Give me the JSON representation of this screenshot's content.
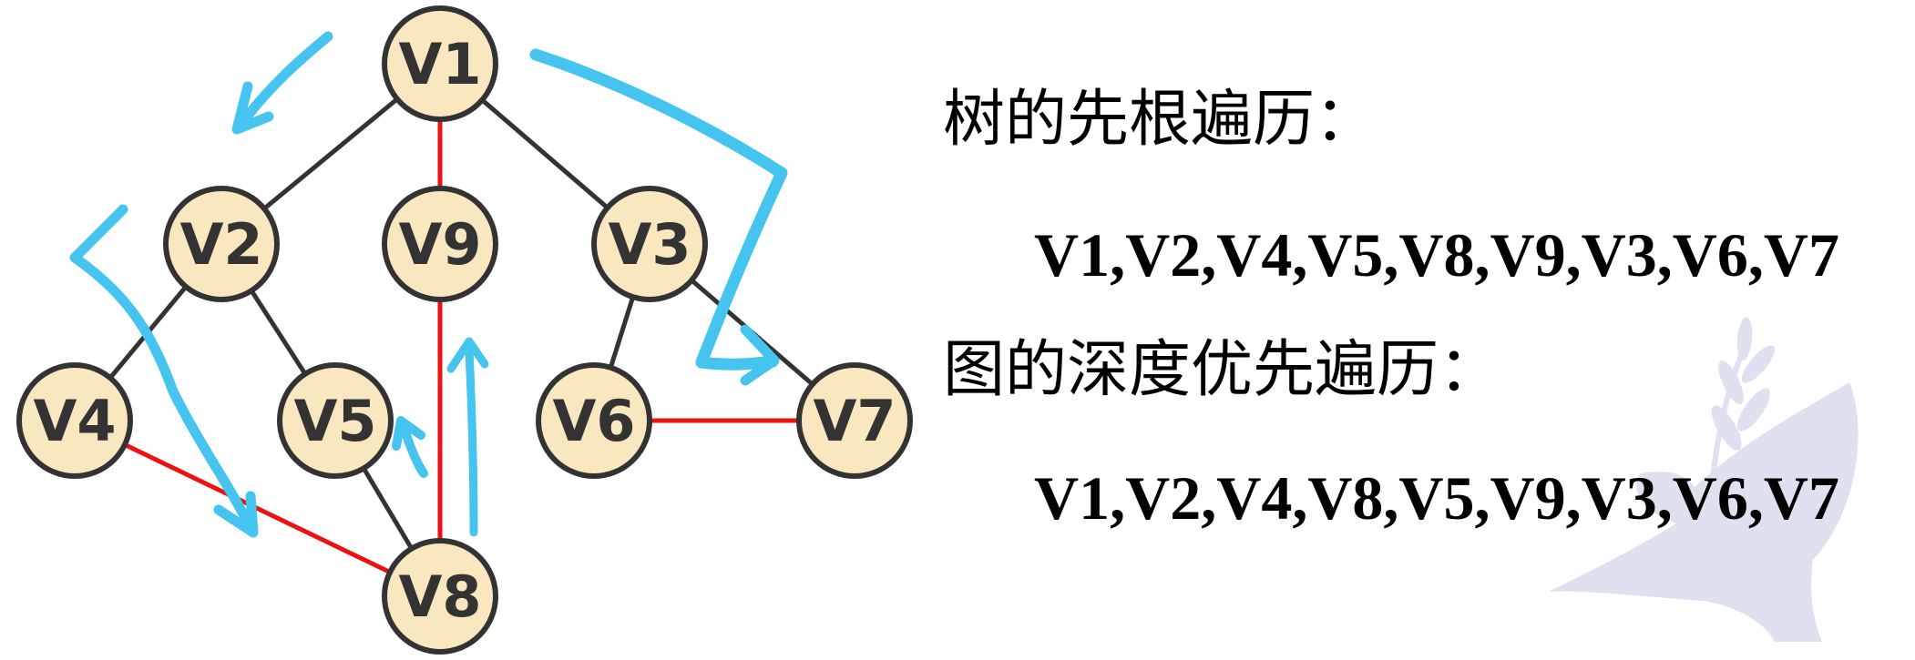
{
  "colors": {
    "node_fill": "#f9e7c0",
    "node_stroke": "#333333",
    "tree_edge": "#333333",
    "graph_edge": "#ee1111",
    "arrow": "#45c4f0",
    "watermark": "#dfe1f0"
  },
  "nodes": [
    {
      "id": "V1",
      "label": "V1"
    },
    {
      "id": "V2",
      "label": "V2"
    },
    {
      "id": "V9",
      "label": "V9"
    },
    {
      "id": "V3",
      "label": "V3"
    },
    {
      "id": "V4",
      "label": "V4"
    },
    {
      "id": "V5",
      "label": "V5"
    },
    {
      "id": "V6",
      "label": "V6"
    },
    {
      "id": "V7",
      "label": "V7"
    },
    {
      "id": "V8",
      "label": "V8"
    }
  ],
  "tree_edges": [
    [
      "V1",
      "V2"
    ],
    [
      "V1",
      "V9"
    ],
    [
      "V1",
      "V3"
    ],
    [
      "V2",
      "V4"
    ],
    [
      "V2",
      "V5"
    ],
    [
      "V5",
      "V8"
    ],
    [
      "V3",
      "V6"
    ],
    [
      "V3",
      "V7"
    ]
  ],
  "graph_edges": [
    [
      "V4",
      "V8"
    ],
    [
      "V8",
      "V9"
    ],
    [
      "V6",
      "V7"
    ],
    [
      "V1",
      "V9"
    ]
  ],
  "watermark_icon": "dove-with-olive-branch-icon",
  "text": {
    "tree_heading": "树的先根遍历：",
    "tree_sequence": "V1,V2,V4,V5,V8,V9,V3,V6,V7",
    "graph_heading": "图的深度优先遍历：",
    "graph_sequence": "V1,V2,V4,V8,V5,V9,V3,V6,V7"
  }
}
